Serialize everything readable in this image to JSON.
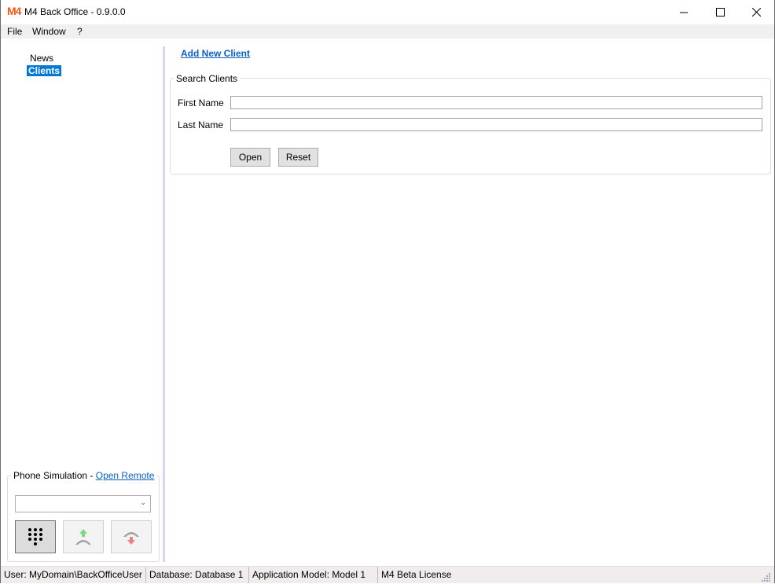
{
  "window": {
    "title": "M4 Back Office - 0.9.0.0",
    "logo_text": "M4",
    "controls": {
      "minimize": "—",
      "maximize": "☐",
      "close": "✕"
    }
  },
  "menubar": {
    "items": [
      {
        "label": "File"
      },
      {
        "label": "Window"
      },
      {
        "label": "?"
      }
    ]
  },
  "navigation": {
    "items": [
      {
        "label": "News",
        "selected": false
      },
      {
        "label": "Clients",
        "selected": true
      }
    ]
  },
  "main": {
    "add_client_link": "Add New Client",
    "search": {
      "title": "Search Clients",
      "first_name_label": "First Name",
      "first_name_value": "",
      "last_name_label": "Last Name",
      "last_name_value": "",
      "open_button": "Open",
      "reset_button": "Reset"
    }
  },
  "phone_simulation": {
    "title": "Phone Simulation - ",
    "open_remote_link": "Open Remote",
    "selected_line": "",
    "buttons": [
      {
        "icon": "dialpad-icon",
        "enabled": true
      },
      {
        "icon": "answer-call-icon",
        "enabled": false
      },
      {
        "icon": "hang-up-icon",
        "enabled": false
      }
    ],
    "colors": {
      "answer": "#7fd87f",
      "hangup": "#f08080",
      "handset": "#a0a0a0"
    }
  },
  "statusbar": {
    "user": "User: MyDomain\\BackOfficeUser",
    "database": "Database: Database 1",
    "app_model": "Application Model: Model 1",
    "license": "M4 Beta License"
  },
  "colors": {
    "accent": "#0078d7",
    "link": "#0b5fc6",
    "logo": "#f05a1a",
    "splitter": "#d9d5f5"
  }
}
